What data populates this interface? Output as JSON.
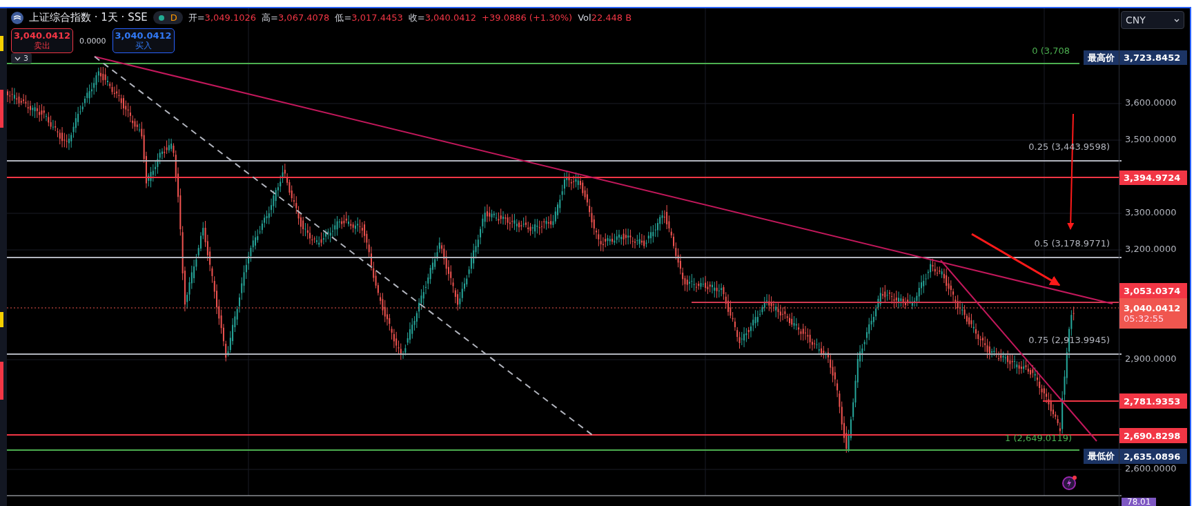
{
  "symbol": {
    "title": "上证综合指数 · 1天 · SSE",
    "interval_badge": "D",
    "market_open": true
  },
  "ohlc": [
    {
      "label": "开=",
      "value": "3,049.1026"
    },
    {
      "label": "高=",
      "value": "3,067.4078"
    },
    {
      "label": "低=",
      "value": "3,017.4453"
    },
    {
      "label": "收=",
      "value": "3,040.0412"
    }
  ],
  "change": "+39.0886 (+1.30%)",
  "volume": {
    "label": "Vol",
    "value": "22.448 B"
  },
  "trade": {
    "sell_price": "3,040.0412",
    "sell_label": "卖出",
    "spread": "0.0000",
    "buy_price": "3,040.0412",
    "buy_label": "买入"
  },
  "indicators_toggle": {
    "label": "3",
    "expanded": false
  },
  "currency": "CNY",
  "price_ticks": [
    "3,600.0000",
    "3,500.0000",
    "3,300.0000",
    "3,200.0000",
    "2,900.0000",
    "2,600.0000"
  ],
  "price_labels": [
    {
      "kind": "high",
      "tag": "最高价",
      "value": "3,723.8452"
    },
    {
      "kind": "level",
      "value": "3,394.9724"
    },
    {
      "kind": "level",
      "value": "3,053.0374"
    },
    {
      "kind": "last",
      "value": "3,040.0412",
      "countdown": "05:32:55"
    },
    {
      "kind": "level",
      "value": "2,781.9353"
    },
    {
      "kind": "level",
      "value": "2,690.8298"
    },
    {
      "kind": "low",
      "tag": "最低价",
      "value": "2,635.0896"
    }
  ],
  "fib_levels": [
    {
      "label": "0 (3,708",
      "color": "#4caf50"
    },
    {
      "label": "0.25 (3,443.9598)",
      "color": "#b2b5be"
    },
    {
      "label": "0.5 (3,178.9771)",
      "color": "#b2b5be"
    },
    {
      "label": "0.75 (2,913.9945)",
      "color": "#b2b5be"
    },
    {
      "label": "1 (2,649.0119)",
      "color": "#4caf50"
    }
  ],
  "indicator_pane": {
    "value": "78.01"
  }
}
